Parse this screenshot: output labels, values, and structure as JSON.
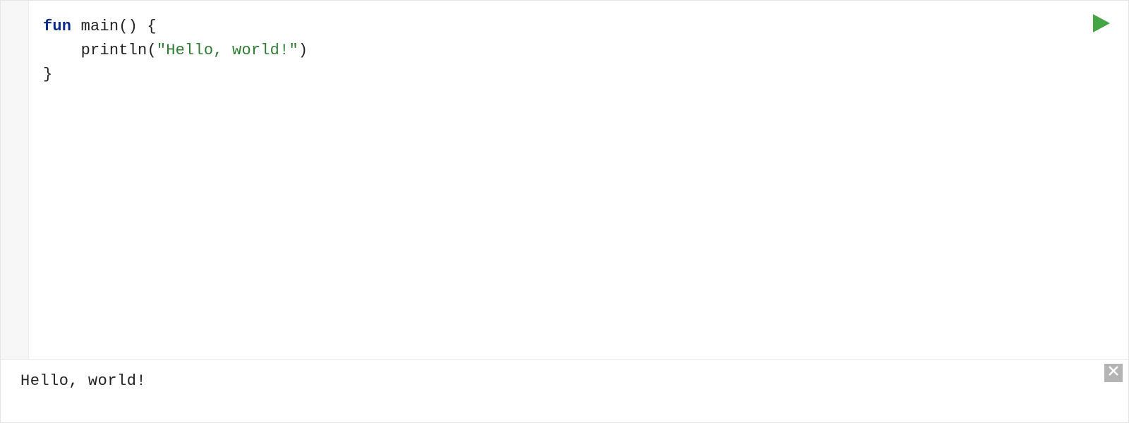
{
  "code": {
    "line1_keyword": "fun",
    "line1_rest": " main() {",
    "line2_indent": "    ",
    "line2_fn": "println",
    "line2_open": "(",
    "line2_string": "\"Hello, world!\"",
    "line2_close": ")",
    "line3": "}"
  },
  "output": {
    "text": "Hello, world!"
  },
  "icons": {
    "run": "play-icon",
    "close": "close-icon"
  },
  "colors": {
    "keyword": "#0b2b8a",
    "string": "#2e7d32",
    "play": "#45a545",
    "closeBg": "#b4b4b4"
  }
}
